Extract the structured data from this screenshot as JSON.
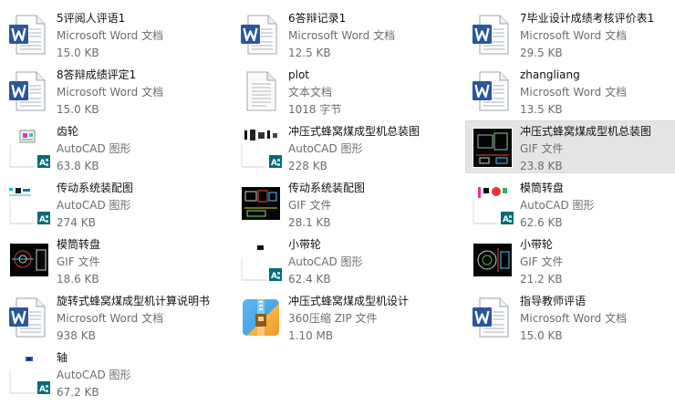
{
  "colors": {
    "word_blue": "#2b579a",
    "autocad_teal": "#0b6b74",
    "zip_orange": "#f3a63a",
    "text_secondary": "#6d6d6d"
  },
  "files": [
    {
      "name": "5评阅人评语1",
      "type": "Microsoft Word 文档",
      "size": "15.0 KB",
      "icon": "word-doc-icon"
    },
    {
      "name": "6答辩记录1",
      "type": "Microsoft Word 文档",
      "size": "12.5 KB",
      "icon": "word-doc-icon"
    },
    {
      "name": "7毕业设计成绩考核评价表1",
      "type": "Microsoft Word 文档",
      "size": "29.5 KB",
      "icon": "word-doc-icon"
    },
    {
      "name": "8答辩成绩评定1",
      "type": "Microsoft Word 文档",
      "size": "15.0 KB",
      "icon": "word-doc-icon"
    },
    {
      "name": "plot",
      "type": "文本文档",
      "size": "1018 字节",
      "icon": "text-doc-icon"
    },
    {
      "name": "zhangliang",
      "type": "Microsoft Word 文档",
      "size": "13.5 KB",
      "icon": "word-doc-icon"
    },
    {
      "name": "齿轮",
      "type": "AutoCAD 图形",
      "size": "63.8 KB",
      "icon": "autocad-drawing-icon"
    },
    {
      "name": "冲压式蜂窝煤成型机总装图",
      "type": "AutoCAD 图形",
      "size": "228 KB",
      "icon": "autocad-drawing-icon"
    },
    {
      "name": "冲压式蜂窝煤成型机总装图",
      "type": "GIF 文件",
      "size": "23.8 KB",
      "icon": "gif-image-icon",
      "selected": true
    },
    {
      "name": "传动系统装配图",
      "type": "AutoCAD 图形",
      "size": "274 KB",
      "icon": "autocad-drawing-icon"
    },
    {
      "name": "传动系统装配图",
      "type": "GIF 文件",
      "size": "28.1 KB",
      "icon": "gif-image-icon"
    },
    {
      "name": "模筒转盘",
      "type": "AutoCAD 图形",
      "size": "62.6 KB",
      "icon": "autocad-drawing-icon"
    },
    {
      "name": "模筒转盘",
      "type": "GIF 文件",
      "size": "18.6 KB",
      "icon": "gif-image-icon"
    },
    {
      "name": "小带轮",
      "type": "AutoCAD 图形",
      "size": "62.4 KB",
      "icon": "autocad-drawing-icon"
    },
    {
      "name": "小带轮",
      "type": "GIF 文件",
      "size": "21.2 KB",
      "icon": "gif-image-icon"
    },
    {
      "name": "旋转式蜂窝煤成型机计算说明书",
      "type": "Microsoft Word 文档",
      "size": "938 KB",
      "icon": "word-doc-icon"
    },
    {
      "name": "冲压式蜂窝煤成型机设计",
      "type": "360压缩 ZIP 文件",
      "size": "1.10 MB",
      "icon": "zip-archive-icon"
    },
    {
      "name": "指导教师评语",
      "type": "Microsoft Word 文档",
      "size": "15.0 KB",
      "icon": "word-doc-icon"
    },
    {
      "name": "轴",
      "type": "AutoCAD 图形",
      "size": "67.2 KB",
      "icon": "autocad-drawing-icon"
    }
  ]
}
